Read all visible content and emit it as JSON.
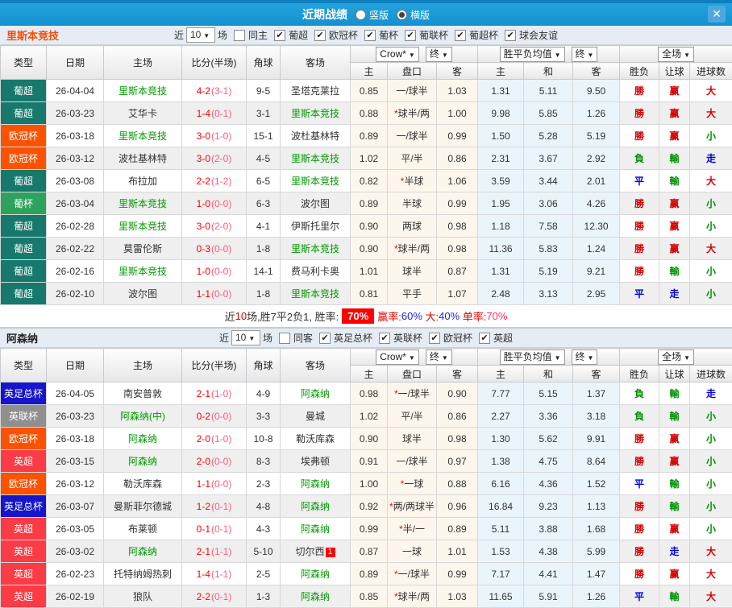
{
  "icons": {
    "close": "✕",
    "dropdown_arrow": "▼",
    "check": "✔"
  },
  "titlebar": {
    "title": "近期战绩",
    "layout_options": [
      {
        "label": "竖版",
        "selected": false
      },
      {
        "label": "横版",
        "selected": true
      }
    ]
  },
  "header": {
    "cols": [
      "类型",
      "日期",
      "主场",
      "比分(半场)",
      "角球",
      "客场"
    ],
    "sub": [
      "主",
      "盘口",
      "客",
      "主",
      "和",
      "客",
      "胜负",
      "让球",
      "进球数"
    ],
    "dropdowns": {
      "bookmaker": "Crow*",
      "final1": "终",
      "avg": "胜平负均值",
      "final2": "终",
      "scope": "全场"
    }
  },
  "sections": [
    {
      "team": "里斯本竞技",
      "team_color": "#ff4a00",
      "filter": {
        "prefix": "近",
        "count": "10",
        "suffix": "场",
        "same": {
          "label": "同主",
          "checked": false
        },
        "leagues": [
          {
            "label": "葡超",
            "checked": true
          },
          {
            "label": "欧冠杯",
            "checked": true
          },
          {
            "label": "葡杯",
            "checked": true
          },
          {
            "label": "葡联杯",
            "checked": true
          },
          {
            "label": "葡超杯",
            "checked": true
          },
          {
            "label": "球会友谊",
            "checked": true
          }
        ]
      },
      "rows": [
        {
          "league": "葡超",
          "league_color": "#17786c",
          "date": "26-04-04",
          "home": "里斯本竞技",
          "home_focus": true,
          "score": "4-2",
          "half": "(3-1)",
          "corners": "9-5",
          "away": "圣塔克莱拉",
          "away_focus": false,
          "odds": [
            "0.85",
            "一/球半",
            "1.03"
          ],
          "avg": [
            "1.31",
            "5.11",
            "9.50"
          ],
          "results": [
            {
              "t": "勝",
              "c": "r"
            },
            {
              "t": "赢",
              "c": "r"
            },
            {
              "t": "大",
              "c": "r"
            }
          ]
        },
        {
          "league": "葡超",
          "league_color": "#17786c",
          "date": "26-03-23",
          "home": "艾华卡",
          "home_focus": false,
          "score": "1-4",
          "half": "(0-1)",
          "corners": "3-1",
          "away": "里斯本竞技",
          "away_focus": true,
          "odds": [
            "0.88",
            "*球半/两",
            "1.00"
          ],
          "avg": [
            "9.98",
            "5.85",
            "1.26"
          ],
          "results": [
            {
              "t": "勝",
              "c": "r"
            },
            {
              "t": "赢",
              "c": "r"
            },
            {
              "t": "大",
              "c": "r"
            }
          ]
        },
        {
          "league": "欧冠杯",
          "league_color": "#fb5200",
          "date": "26-03-18",
          "home": "里斯本竞技",
          "home_focus": true,
          "score": "3-0",
          "half": "(1-0)",
          "corners": "15-1",
          "away": "波杜基林特",
          "away_focus": false,
          "odds": [
            "0.89",
            "一/球半",
            "0.99"
          ],
          "avg": [
            "1.50",
            "5.28",
            "5.19"
          ],
          "results": [
            {
              "t": "勝",
              "c": "r"
            },
            {
              "t": "赢",
              "c": "r"
            },
            {
              "t": "小",
              "c": "g"
            }
          ]
        },
        {
          "league": "欧冠杯",
          "league_color": "#fb5200",
          "date": "26-03-12",
          "home": "波杜基林特",
          "home_focus": false,
          "score": "3-0",
          "half": "(2-0)",
          "corners": "4-5",
          "away": "里斯本竞技",
          "away_focus": true,
          "odds": [
            "1.02",
            "平/半",
            "0.86"
          ],
          "avg": [
            "2.31",
            "3.67",
            "2.92"
          ],
          "results": [
            {
              "t": "負",
              "c": "g"
            },
            {
              "t": "輸",
              "c": "g"
            },
            {
              "t": "走",
              "c": "b"
            }
          ]
        },
        {
          "league": "葡超",
          "league_color": "#17786c",
          "date": "26-03-08",
          "home": "布拉加",
          "home_focus": false,
          "score": "2-2",
          "half": "(1-2)",
          "corners": "6-5",
          "away": "里斯本竞技",
          "away_focus": true,
          "odds": [
            "0.82",
            "*半球",
            "1.06"
          ],
          "avg": [
            "3.59",
            "3.44",
            "2.01"
          ],
          "results": [
            {
              "t": "平",
              "c": "b"
            },
            {
              "t": "輸",
              "c": "g"
            },
            {
              "t": "大",
              "c": "r"
            }
          ]
        },
        {
          "league": "葡杯",
          "league_color": "#2ba35d",
          "date": "26-03-04",
          "home": "里斯本竞技",
          "home_focus": true,
          "score": "1-0",
          "half": "(0-0)",
          "corners": "6-3",
          "away": "波尔图",
          "away_focus": false,
          "odds": [
            "0.89",
            "半球",
            "0.99"
          ],
          "avg": [
            "1.95",
            "3.06",
            "4.26"
          ],
          "results": [
            {
              "t": "勝",
              "c": "r"
            },
            {
              "t": "赢",
              "c": "r"
            },
            {
              "t": "小",
              "c": "g"
            }
          ]
        },
        {
          "league": "葡超",
          "league_color": "#17786c",
          "date": "26-02-28",
          "home": "里斯本竞技",
          "home_focus": true,
          "score": "3-0",
          "half": "(2-0)",
          "corners": "4-1",
          "away": "伊斯托里尔",
          "away_focus": false,
          "odds": [
            "0.90",
            "两球",
            "0.98"
          ],
          "avg": [
            "1.18",
            "7.58",
            "12.30"
          ],
          "results": [
            {
              "t": "勝",
              "c": "r"
            },
            {
              "t": "赢",
              "c": "r"
            },
            {
              "t": "小",
              "c": "g"
            }
          ]
        },
        {
          "league": "葡超",
          "league_color": "#17786c",
          "date": "26-02-22",
          "home": "莫雷伦斯",
          "home_focus": false,
          "score": "0-3",
          "half": "(0-0)",
          "corners": "1-8",
          "away": "里斯本竞技",
          "away_focus": true,
          "odds": [
            "0.90",
            "*球半/两",
            "0.98"
          ],
          "avg": [
            "11.36",
            "5.83",
            "1.24"
          ],
          "results": [
            {
              "t": "勝",
              "c": "r"
            },
            {
              "t": "赢",
              "c": "r"
            },
            {
              "t": "大",
              "c": "r"
            }
          ]
        },
        {
          "league": "葡超",
          "league_color": "#17786c",
          "date": "26-02-16",
          "home": "里斯本竞技",
          "home_focus": true,
          "score": "1-0",
          "half": "(0-0)",
          "corners": "14-1",
          "away": "费马利卡奥",
          "away_focus": false,
          "odds": [
            "1.01",
            "球半",
            "0.87"
          ],
          "avg": [
            "1.31",
            "5.19",
            "9.21"
          ],
          "results": [
            {
              "t": "勝",
              "c": "r"
            },
            {
              "t": "輸",
              "c": "g"
            },
            {
              "t": "小",
              "c": "g"
            }
          ]
        },
        {
          "league": "葡超",
          "league_color": "#17786c",
          "date": "26-02-10",
          "home": "波尔图",
          "home_focus": false,
          "score": "1-1",
          "half": "(0-0)",
          "corners": "1-8",
          "away": "里斯本竞技",
          "away_focus": true,
          "odds": [
            "0.81",
            "平手",
            "1.07"
          ],
          "avg": [
            "2.48",
            "3.13",
            "2.95"
          ],
          "results": [
            {
              "t": "平",
              "c": "b"
            },
            {
              "t": "走",
              "c": "b"
            },
            {
              "t": "小",
              "c": "g"
            }
          ]
        }
      ],
      "summary": {
        "parts": [
          {
            "t": "近",
            "c": "k"
          },
          {
            "t": "10",
            "c": "r"
          },
          {
            "t": "场,胜7平2负1, 胜率:",
            "c": "k"
          },
          {
            "t": "70%",
            "c": "chip"
          },
          {
            "t": "赢率:",
            "c": "r"
          },
          {
            "t": "60%",
            "c": "b"
          },
          {
            "t": " 大:",
            "c": "r"
          },
          {
            "t": "40%",
            "c": "b"
          },
          {
            "t": " 单率:",
            "c": "r"
          },
          {
            "t": "70%",
            "c": "p"
          }
        ]
      }
    },
    {
      "team": "阿森纳",
      "team_color": "#222222",
      "filter": {
        "prefix": "近",
        "count": "10",
        "suffix": "场",
        "same": {
          "label": "同客",
          "checked": false
        },
        "leagues": [
          {
            "label": "英足总杯",
            "checked": true
          },
          {
            "label": "英联杯",
            "checked": true
          },
          {
            "label": "欧冠杯",
            "checked": true
          },
          {
            "label": "英超",
            "checked": true
          }
        ]
      },
      "rows": [
        {
          "league": "英足总杯",
          "league_color": "#1515cc",
          "date": "26-04-05",
          "home": "南安普敦",
          "home_focus": false,
          "score": "2-1",
          "half": "(1-0)",
          "corners": "4-9",
          "away": "阿森纳",
          "away_focus": true,
          "odds": [
            "0.98",
            "*一/球半",
            "0.90"
          ],
          "avg": [
            "7.77",
            "5.15",
            "1.37"
          ],
          "results": [
            {
              "t": "負",
              "c": "g"
            },
            {
              "t": "輸",
              "c": "g"
            },
            {
              "t": "走",
              "c": "b"
            }
          ]
        },
        {
          "league": "英联杯",
          "league_color": "#8f8f8f",
          "date": "26-03-23",
          "home": "阿森纳(中)",
          "home_focus": true,
          "score": "0-2",
          "half": "(0-0)",
          "corners": "3-3",
          "away": "曼城",
          "away_focus": false,
          "odds": [
            "1.02",
            "平/半",
            "0.86"
          ],
          "avg": [
            "2.27",
            "3.36",
            "3.18"
          ],
          "results": [
            {
              "t": "負",
              "c": "g"
            },
            {
              "t": "輸",
              "c": "g"
            },
            {
              "t": "小",
              "c": "g"
            }
          ]
        },
        {
          "league": "欧冠杯",
          "league_color": "#fb5200",
          "date": "26-03-18",
          "home": "阿森纳",
          "home_focus": true,
          "score": "2-0",
          "half": "(1-0)",
          "corners": "10-8",
          "away": "勒沃库森",
          "away_focus": false,
          "odds": [
            "0.90",
            "球半",
            "0.98"
          ],
          "avg": [
            "1.30",
            "5.62",
            "9.91"
          ],
          "results": [
            {
              "t": "勝",
              "c": "r"
            },
            {
              "t": "赢",
              "c": "r"
            },
            {
              "t": "小",
              "c": "g"
            }
          ]
        },
        {
          "league": "英超",
          "league_color": "#fb3b45",
          "date": "26-03-15",
          "home": "阿森纳",
          "home_focus": true,
          "score": "2-0",
          "half": "(0-0)",
          "corners": "8-3",
          "away": "埃弗顿",
          "away_focus": false,
          "odds": [
            "0.91",
            "一/球半",
            "0.97"
          ],
          "avg": [
            "1.38",
            "4.75",
            "8.64"
          ],
          "results": [
            {
              "t": "勝",
              "c": "r"
            },
            {
              "t": "赢",
              "c": "r"
            },
            {
              "t": "小",
              "c": "g"
            }
          ]
        },
        {
          "league": "欧冠杯",
          "league_color": "#fb5200",
          "date": "26-03-12",
          "home": "勒沃库森",
          "home_focus": false,
          "score": "1-1",
          "half": "(0-0)",
          "corners": "2-3",
          "away": "阿森纳",
          "away_focus": true,
          "odds": [
            "1.00",
            "*一球",
            "0.88"
          ],
          "avg": [
            "6.16",
            "4.36",
            "1.52"
          ],
          "results": [
            {
              "t": "平",
              "c": "b"
            },
            {
              "t": "輸",
              "c": "g"
            },
            {
              "t": "小",
              "c": "g"
            }
          ]
        },
        {
          "league": "英足总杯",
          "league_color": "#1515cc",
          "date": "26-03-07",
          "home": "曼斯菲尔德城",
          "home_focus": false,
          "score": "1-2",
          "half": "(0-1)",
          "corners": "4-8",
          "away": "阿森纳",
          "away_focus": true,
          "odds": [
            "0.92",
            "*两/两球半",
            "0.96"
          ],
          "avg": [
            "16.84",
            "9.23",
            "1.13"
          ],
          "results": [
            {
              "t": "勝",
              "c": "r"
            },
            {
              "t": "輸",
              "c": "g"
            },
            {
              "t": "小",
              "c": "g"
            }
          ]
        },
        {
          "league": "英超",
          "league_color": "#fb3b45",
          "date": "26-03-05",
          "home": "布莱顿",
          "home_focus": false,
          "score": "0-1",
          "half": "(0-1)",
          "corners": "4-3",
          "away": "阿森纳",
          "away_focus": true,
          "odds": [
            "0.99",
            "*半/一",
            "0.89"
          ],
          "avg": [
            "5.11",
            "3.88",
            "1.68"
          ],
          "results": [
            {
              "t": "勝",
              "c": "r"
            },
            {
              "t": "赢",
              "c": "r"
            },
            {
              "t": "小",
              "c": "g"
            }
          ]
        },
        {
          "league": "英超",
          "league_color": "#fb3b45",
          "date": "26-03-02",
          "home": "阿森纳",
          "home_focus": true,
          "score": "2-1",
          "half": "(1-1)",
          "corners": "5-10",
          "away": "切尔西",
          "away_focus": false,
          "away_badge": "1",
          "odds": [
            "0.87",
            "一球",
            "1.01"
          ],
          "avg": [
            "1.53",
            "4.38",
            "5.99"
          ],
          "results": [
            {
              "t": "勝",
              "c": "r"
            },
            {
              "t": "走",
              "c": "b"
            },
            {
              "t": "大",
              "c": "r"
            }
          ]
        },
        {
          "league": "英超",
          "league_color": "#fb3b45",
          "date": "26-02-23",
          "home": "托特纳姆热刺",
          "home_focus": false,
          "score": "1-4",
          "half": "(1-1)",
          "corners": "2-5",
          "away": "阿森纳",
          "away_focus": true,
          "odds": [
            "0.89",
            "*一/球半",
            "0.99"
          ],
          "avg": [
            "7.17",
            "4.41",
            "1.47"
          ],
          "results": [
            {
              "t": "勝",
              "c": "r"
            },
            {
              "t": "赢",
              "c": "r"
            },
            {
              "t": "大",
              "c": "r"
            }
          ]
        },
        {
          "league": "英超",
          "league_color": "#fb3b45",
          "date": "26-02-19",
          "home": "狼队",
          "home_focus": false,
          "score": "2-2",
          "half": "(0-1)",
          "corners": "1-3",
          "away": "阿森纳",
          "away_focus": true,
          "odds": [
            "0.85",
            "*球半/两",
            "1.03"
          ],
          "avg": [
            "11.65",
            "5.91",
            "1.26"
          ],
          "results": [
            {
              "t": "平",
              "c": "b"
            },
            {
              "t": "輸",
              "c": "g"
            },
            {
              "t": "大",
              "c": "r"
            }
          ]
        }
      ]
    }
  ]
}
